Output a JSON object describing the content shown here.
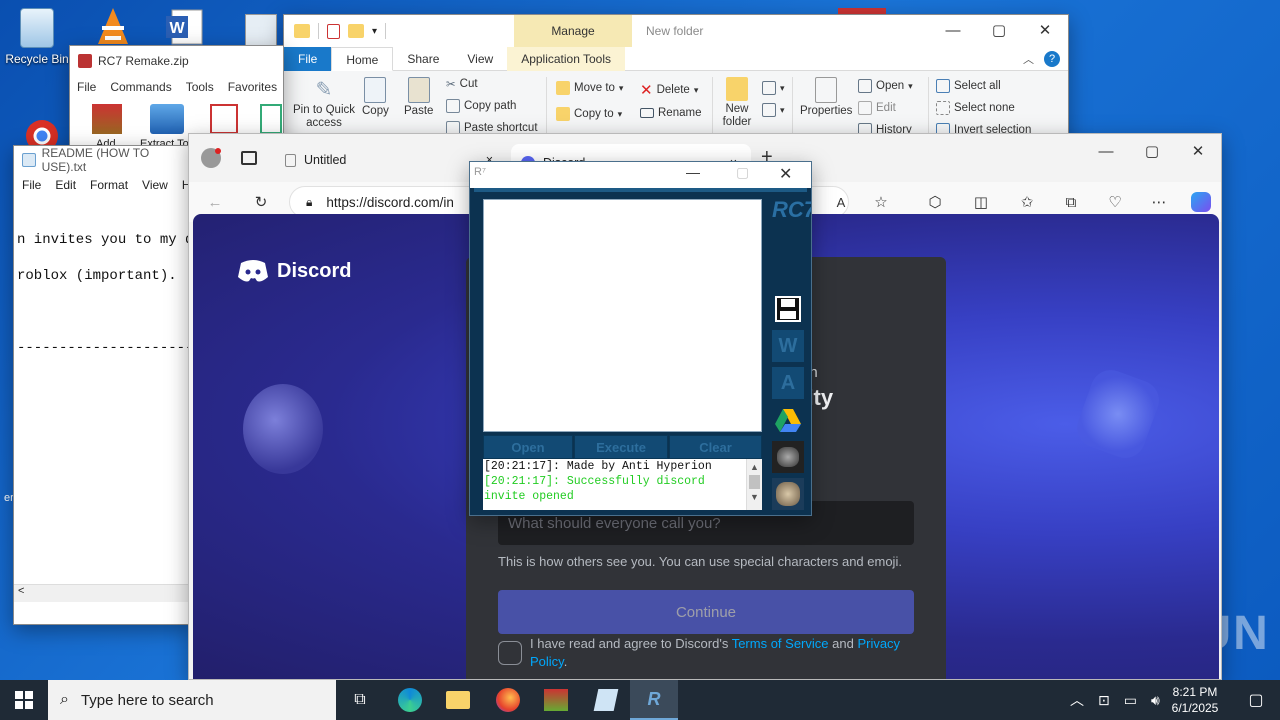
{
  "desktop": {
    "icons": [
      {
        "label": "Recycle Bin"
      }
    ],
    "watermark": "ANY RUN"
  },
  "explorer": {
    "title": "New folder",
    "manage_label": "Manage",
    "tabs": [
      "File",
      "Home",
      "Share",
      "View",
      "Application Tools"
    ],
    "clipboard": {
      "pin": "Pin to Quick access",
      "copy": "Copy",
      "paste": "Paste",
      "cut": "Cut",
      "copy_path": "Copy path",
      "paste_shortcut": "Paste shortcut"
    },
    "organize": {
      "move_to": "Move to",
      "copy_to": "Copy to",
      "delete": "Delete",
      "rename": "Rename"
    },
    "new": {
      "new_folder": "New folder"
    },
    "open": {
      "properties": "Properties",
      "open": "Open",
      "edit": "Edit",
      "history": "History"
    },
    "select": {
      "all": "Select all",
      "none": "Select none",
      "invert": "Invert selection"
    }
  },
  "winrar": {
    "title": "RC7 Remake.zip",
    "menu": [
      "File",
      "Commands",
      "Tools",
      "Favorites"
    ],
    "tool_labels": [
      "Add",
      "Extract To"
    ]
  },
  "notepad": {
    "title": "README (HOW TO USE).txt",
    "menu": [
      "File",
      "Edit",
      "Format",
      "View",
      "H"
    ],
    "lines": [
      "n invites you to my di",
      "roblox (important).",
      "------------------------"
    ],
    "scroll_left": "<"
  },
  "edge": {
    "tabs": [
      {
        "label": "Untitled",
        "close": "×"
      },
      {
        "label": "Discord",
        "close": "×"
      }
    ],
    "new_tab": "+",
    "url": "https://discord.com/in",
    "win_ctrls": [
      "—",
      "▢",
      "✕"
    ]
  },
  "discord": {
    "logo_text": "Discord",
    "heading_partial": "in",
    "heading_partial2": "nity",
    "name_placeholder": "What should everyone call you?",
    "name_note": "This is how others see you. You can use special characters and emoji.",
    "continue": "Continue",
    "tos_prefix": "I have read and agree to Discord's ",
    "tos_link": "Terms of Service",
    "tos_and": " and ",
    "privacy_link": "Privacy Policy",
    "tos_suffix": "."
  },
  "rc7": {
    "side_title": "RC7",
    "buttons": [
      "Open",
      "Execute",
      "Clear"
    ],
    "side_letters": [
      "W",
      "A"
    ],
    "log": [
      {
        "text": "[20:21:17]: Made by Anti Hyperion",
        "color": "#111111"
      },
      {
        "text": "[20:21:17]: Successfully discord invite opened",
        "color": "#22cc22"
      }
    ]
  },
  "taskbar": {
    "search_placeholder": "Type here to search",
    "time": "8:21 PM",
    "date": "6/1/2025"
  }
}
